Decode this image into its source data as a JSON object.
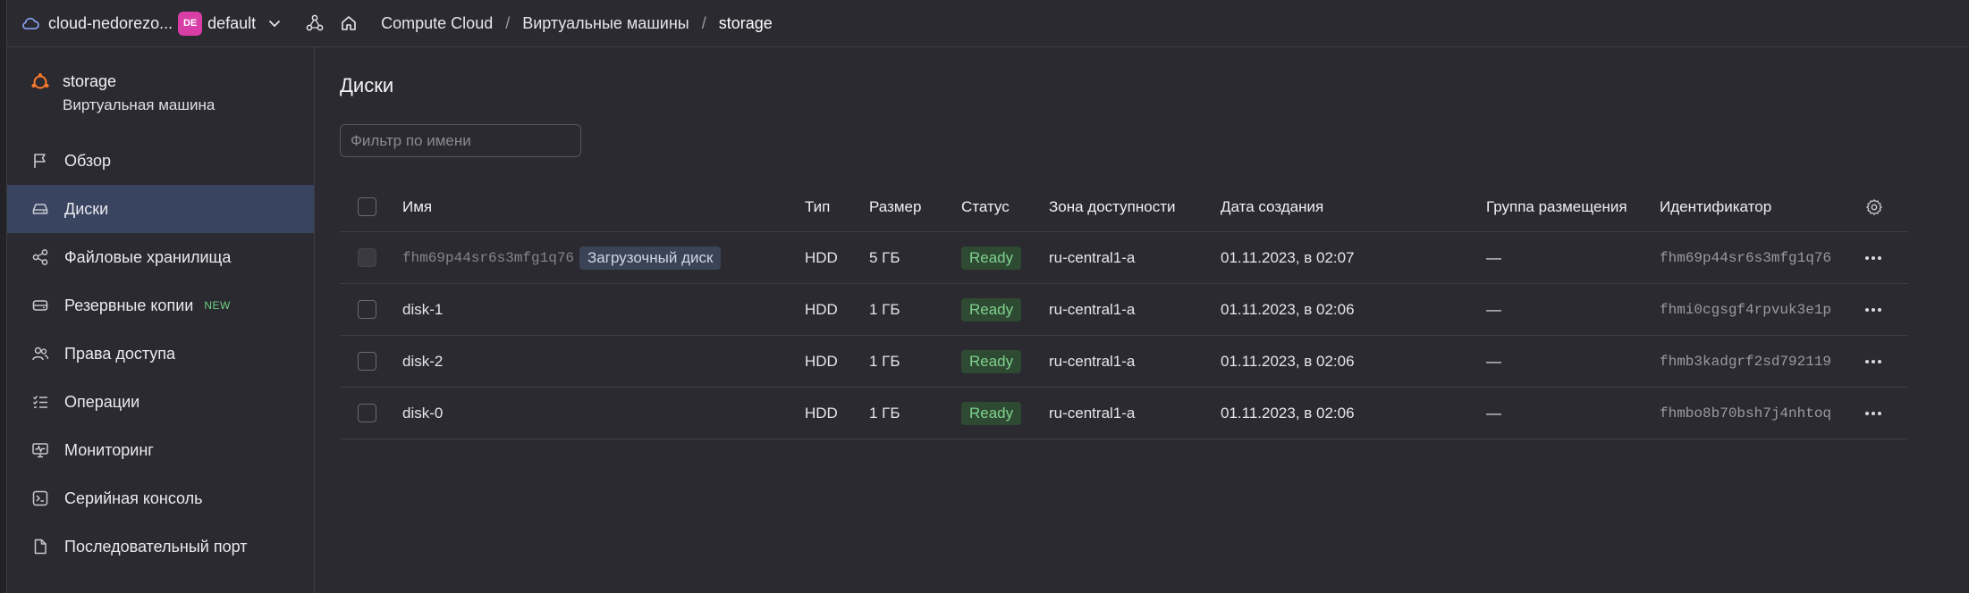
{
  "topbar": {
    "cloud_name": "cloud-nedorezo...",
    "folder_badge": "DE",
    "folder_name": "default",
    "breadcrumbs": [
      "Compute Cloud",
      "Виртуальные машины",
      "storage"
    ],
    "separator": "/"
  },
  "sidebar": {
    "vm_name": "storage",
    "vm_type": "Виртуальная машина",
    "items": [
      {
        "label": "Обзор",
        "icon": "flag-icon"
      },
      {
        "label": "Диски",
        "icon": "disk-icon",
        "active": true
      },
      {
        "label": "Файловые хранилища",
        "icon": "share-icon"
      },
      {
        "label": "Резервные копии",
        "icon": "backup-icon",
        "badge": "NEW"
      },
      {
        "label": "Права доступа",
        "icon": "users-icon"
      },
      {
        "label": "Операции",
        "icon": "list-check-icon"
      },
      {
        "label": "Мониторинг",
        "icon": "monitoring-icon"
      },
      {
        "label": "Серийная консоль",
        "icon": "terminal-icon"
      },
      {
        "label": "Последовательный порт",
        "icon": "file-icon"
      }
    ]
  },
  "main": {
    "title": "Диски",
    "filter_placeholder": "Фильтр по имени",
    "columns": [
      "Имя",
      "Тип",
      "Размер",
      "Статус",
      "Зона доступности",
      "Дата создания",
      "Группа размещения",
      "Идентификатор"
    ],
    "rows": [
      {
        "name": "fhm69p44sr6s3mfg1q76",
        "boot_tag": "Загрузочный диск",
        "type": "HDD",
        "size": "5 ГБ",
        "status": "Ready",
        "zone": "ru-central1-a",
        "created": "01.11.2023, в 02:07",
        "group": "—",
        "id": "fhm69p44sr6s3mfg1q76"
      },
      {
        "name": "disk-1",
        "type": "HDD",
        "size": "1 ГБ",
        "status": "Ready",
        "zone": "ru-central1-a",
        "created": "01.11.2023, в 02:06",
        "group": "—",
        "id": "fhmi0cgsgf4rpvuk3e1p"
      },
      {
        "name": "disk-2",
        "type": "HDD",
        "size": "1 ГБ",
        "status": "Ready",
        "zone": "ru-central1-a",
        "created": "01.11.2023, в 02:06",
        "group": "—",
        "id": "fhmb3kadgrf2sd792119"
      },
      {
        "name": "disk-0",
        "type": "HDD",
        "size": "1 ГБ",
        "status": "Ready",
        "zone": "ru-central1-a",
        "created": "01.11.2023, в 02:06",
        "group": "—",
        "id": "fhmbo8b70bsh7j4nhtoq"
      }
    ]
  },
  "colors": {
    "accent_active": "#394460",
    "status_ready_bg": "#2f4a33",
    "status_ready_text": "#7ed28c",
    "folder_badge": "#d93ea7",
    "vm_icon": "#ff7a2b",
    "new_badge": "#6fd083"
  }
}
